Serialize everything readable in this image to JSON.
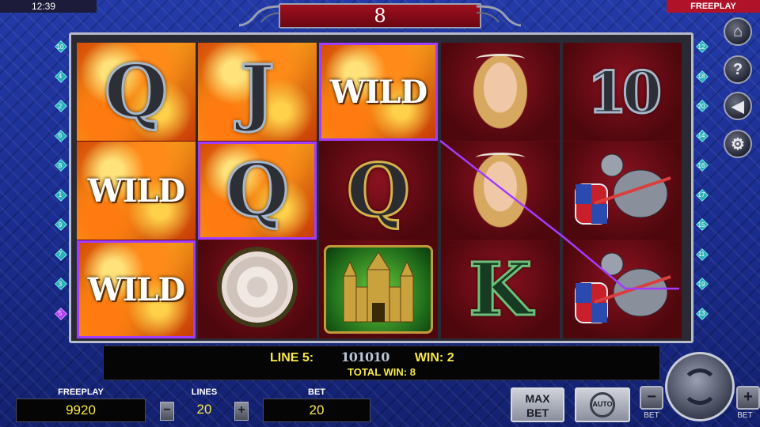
{
  "status": {
    "clock": "12:39",
    "mode": "FREEPLAY"
  },
  "free_spins": {
    "count": "8"
  },
  "reels": [
    [
      {
        "type": "letter",
        "text": "Q",
        "style": "silver",
        "bg": "fire"
      },
      {
        "type": "wild",
        "text": "WILD",
        "bg": "fire"
      },
      {
        "type": "wild",
        "text": "WILD",
        "bg": "fire",
        "highlight": true
      }
    ],
    [
      {
        "type": "letter",
        "text": "J",
        "style": "silver",
        "bg": "fire"
      },
      {
        "type": "letter",
        "text": "Q",
        "style": "silver",
        "bg": "fire",
        "highlight": true
      },
      {
        "type": "rose",
        "bg": "dark"
      }
    ],
    [
      {
        "type": "wild",
        "text": "WILD",
        "bg": "fire",
        "highlight": true
      },
      {
        "type": "letter",
        "text": "Q",
        "style": "gold",
        "bg": "dark"
      },
      {
        "type": "castle",
        "bg": "dark"
      }
    ],
    [
      {
        "type": "lady",
        "bg": "dark"
      },
      {
        "type": "lady",
        "bg": "dark"
      },
      {
        "type": "letter",
        "text": "K",
        "style": "green",
        "bg": "dark"
      }
    ],
    [
      {
        "type": "letter",
        "text": "10",
        "style": "silver",
        "bg": "dark"
      },
      {
        "type": "knight",
        "bg": "dark"
      },
      {
        "type": "knight",
        "bg": "dark"
      }
    ]
  ],
  "line_indicators": {
    "left": [
      "10",
      "4",
      "2",
      "6",
      "8",
      "1",
      "9",
      "7",
      "3",
      "5"
    ],
    "right": [
      "12",
      "18",
      "20",
      "14",
      "16",
      "17",
      "15",
      "11",
      "19",
      "13"
    ],
    "active": "5"
  },
  "side_buttons": [
    {
      "name": "home-button",
      "icon": "home-icon",
      "glyph": "⌂"
    },
    {
      "name": "help-button",
      "icon": "question-icon",
      "glyph": "?"
    },
    {
      "name": "sound-button",
      "icon": "speaker-muted-icon",
      "glyph": "◀"
    },
    {
      "name": "settings-button",
      "icon": "gear-icon",
      "glyph": "⚙"
    }
  ],
  "message": {
    "line_label": "LINE 5:",
    "line_symbols": "101010",
    "win_label": "WIN: 2",
    "total": "TOTAL WIN: 8"
  },
  "controls": {
    "freeplay_label": "FREEPLAY",
    "freeplay_value": "9920",
    "lines_label": "LINES",
    "lines_value": "20",
    "lines_minus": "−",
    "lines_plus": "+",
    "bet_label": "BET",
    "bet_value": "20",
    "max_bet_line1": "MAX",
    "max_bet_line2": "BET",
    "auto_label": "AUTO",
    "bet_minus": "−",
    "bet_minus_label": "BET",
    "bet_plus": "+",
    "bet_plus_label": "BET"
  },
  "colors": {
    "highlight": "#a23cff",
    "message_text": "#f6e84a",
    "mode_badge": "#b0122a"
  }
}
